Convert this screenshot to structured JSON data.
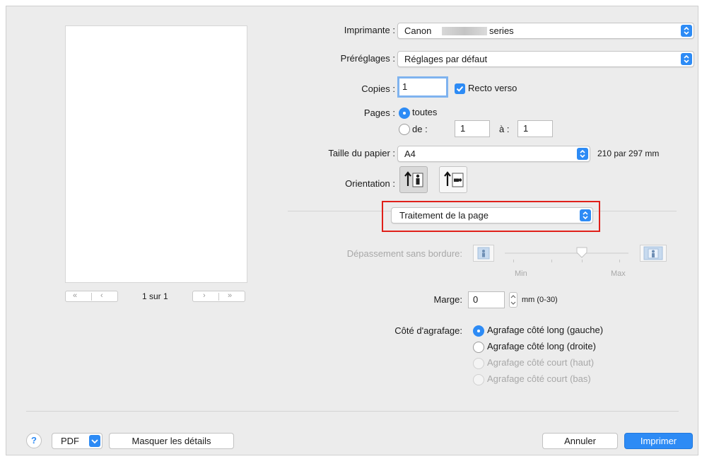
{
  "printer": {
    "label": "Imprimante :",
    "value_prefix": "Canon",
    "value_suffix": "series"
  },
  "presets": {
    "label": "Préréglages :",
    "value": "Réglages par défaut"
  },
  "copies": {
    "label": "Copies :",
    "value": "1",
    "duplex_label": "Recto verso"
  },
  "pages": {
    "label": "Pages :",
    "all_label": "toutes",
    "from_label": "de :",
    "from_value": "1",
    "to_label": "à :",
    "to_value": "1"
  },
  "paper_size": {
    "label": "Taille du papier :",
    "value": "A4",
    "dimensions": "210 par 297 mm"
  },
  "orientation": {
    "label": "Orientation :"
  },
  "section_menu": {
    "value": "Traitement de la page"
  },
  "borderless": {
    "label": "Dépassement sans bordure:",
    "min_label": "Min",
    "max_label": "Max",
    "level": 0.75
  },
  "margin": {
    "label": "Marge:",
    "value": "0",
    "unit": "mm (0-30)"
  },
  "binding": {
    "label": "Côté d'agrafage:",
    "options": [
      "Agrafage côté long (gauche)",
      "Agrafage côté long (droite)",
      "Agrafage côté court (haut)",
      "Agrafage côté court (bas)"
    ]
  },
  "preview": {
    "page_counter": "1 sur 1"
  },
  "footer": {
    "help": "?",
    "pdf_label": "PDF",
    "hide_details_label": "Masquer les détails",
    "cancel_label": "Annuler",
    "print_label": "Imprimer"
  },
  "colors": {
    "accent": "#2d8bf5",
    "highlight_border": "#e0201a"
  }
}
